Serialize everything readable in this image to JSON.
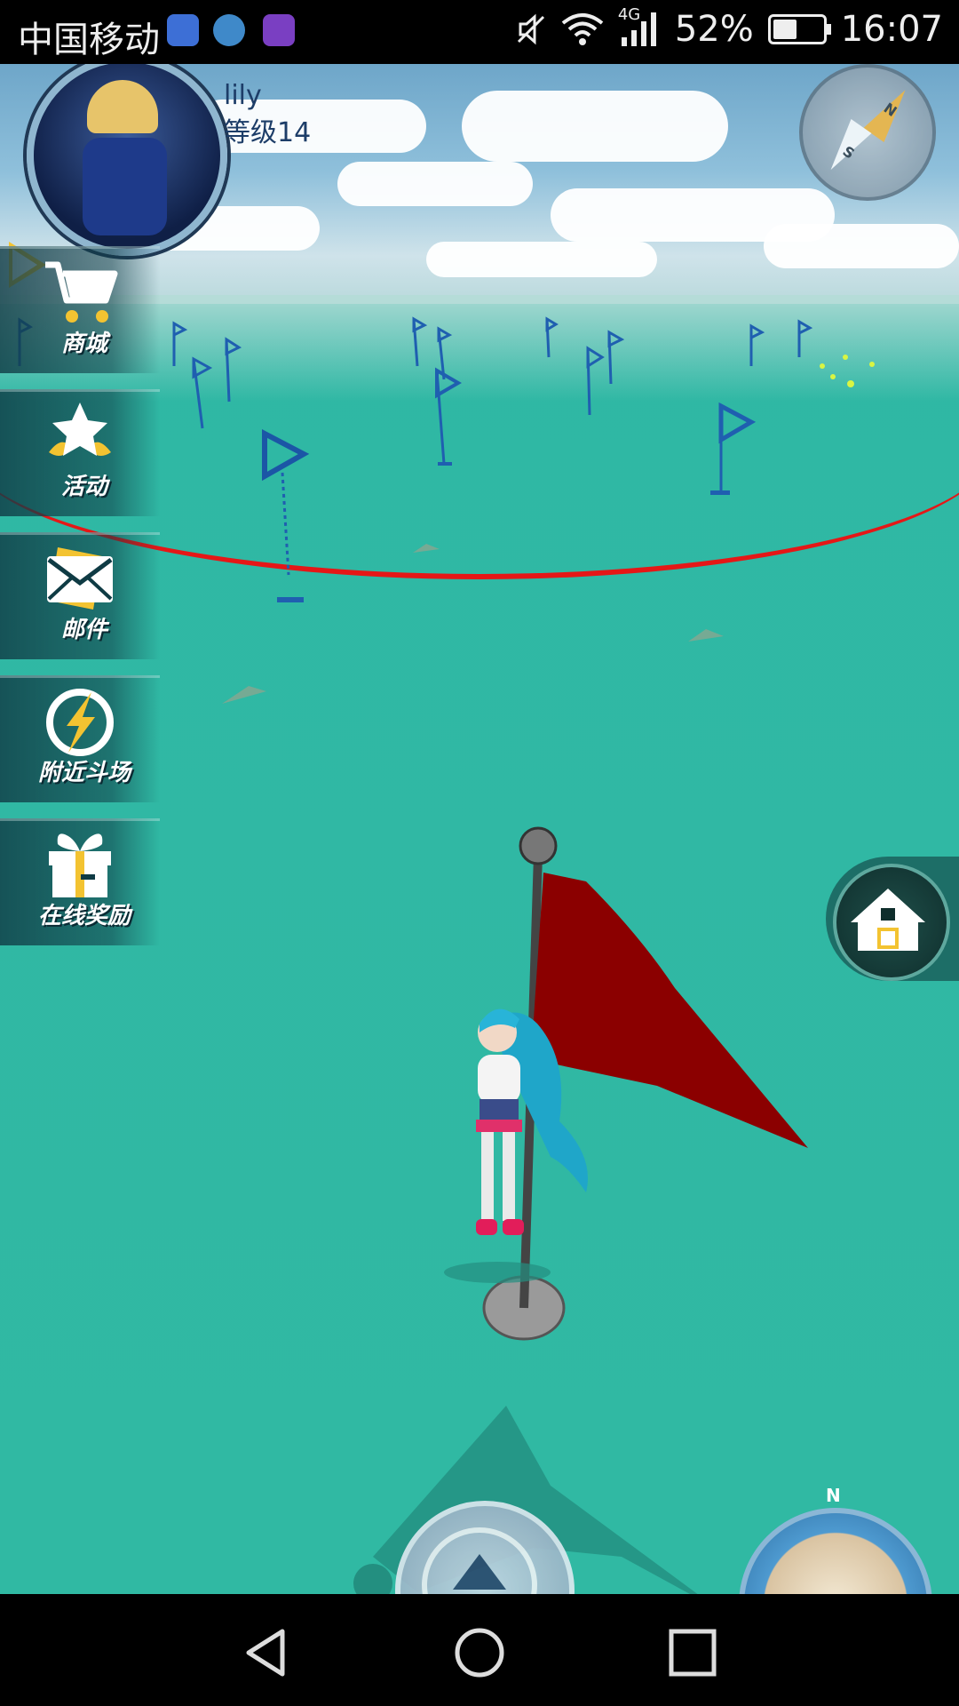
{
  "status_bar": {
    "carrier": "中国移动",
    "network": "4G",
    "battery_percent": "52%",
    "time": "16:07",
    "icons": [
      "location-app-icon",
      "heart-app-icon",
      "gallery-app-icon",
      "mute-icon",
      "wifi-icon",
      "signal-icon",
      "battery-icon"
    ]
  },
  "player": {
    "name": "lily",
    "level": "等级14"
  },
  "menu": {
    "items": [
      {
        "label": "商城",
        "icon": "cart-icon"
      },
      {
        "label": "活动",
        "icon": "star-icon"
      },
      {
        "label": "邮件",
        "icon": "mail-icon"
      },
      {
        "label": "附近斗场",
        "icon": "lightning-icon"
      },
      {
        "label": "在线奖励",
        "icon": "gift-icon"
      }
    ]
  },
  "compass": {
    "n": "N",
    "s": "S"
  },
  "minimap": {
    "n": "N"
  },
  "colors": {
    "boundary": "#e51717",
    "grass": "#2fb7a4",
    "flag": "#8b0000",
    "pin": "#1f5fb0",
    "accent": "#f3c331"
  },
  "nav": {
    "icons": [
      "back-icon",
      "home-circle-icon",
      "recents-icon"
    ]
  }
}
